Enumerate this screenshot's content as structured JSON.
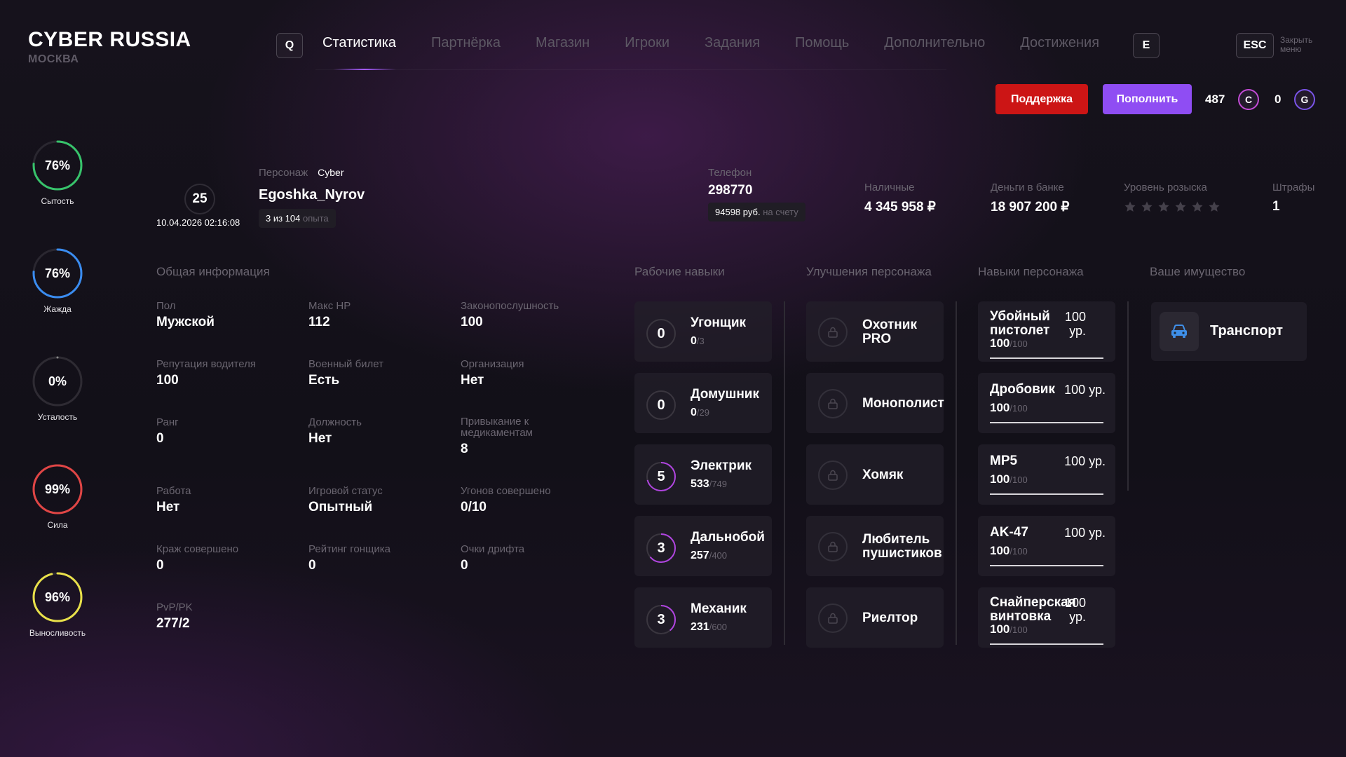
{
  "header": {
    "brand": "CYBER RUSSIA",
    "city": "МОСКВА",
    "left_key": "Q",
    "right_key": "E",
    "tabs": [
      {
        "label": "Статистика"
      },
      {
        "label": "Партнёрка"
      },
      {
        "label": "Магазин"
      },
      {
        "label": "Игроки"
      },
      {
        "label": "Задания"
      },
      {
        "label": "Помощь"
      },
      {
        "label": "Дополнительно"
      },
      {
        "label": "Достижения"
      }
    ],
    "esc_key": "ESC",
    "close_line1": "Закрыть",
    "close_line2": "меню"
  },
  "actions": {
    "support_label": "Поддержка",
    "topup_label": "Пополнить",
    "c_balance": "487",
    "c_symbol": "C",
    "g_balance": "0",
    "g_symbol": "G"
  },
  "stats": [
    {
      "value": "76%",
      "label": "Сытость",
      "fraction": 0.76,
      "color": "#37c36b"
    },
    {
      "value": "76%",
      "label": "Жажда",
      "fraction": 0.76,
      "color": "#3a8cf0"
    },
    {
      "value": "0%",
      "label": "Усталость",
      "fraction": 0.0,
      "color": "#8a8a8a"
    },
    {
      "value": "99%",
      "label": "Сила",
      "fraction": 0.99,
      "color": "#e04545"
    },
    {
      "value": "96%",
      "label": "Выносливость",
      "fraction": 0.96,
      "color": "#e8e04a"
    }
  ],
  "character": {
    "level": "25",
    "datetime": "10.04.2026 02:16:08",
    "character_label": "Персонаж",
    "tag": "Cyber",
    "name": "Egoshka_Nyrov",
    "exp_value": "3 из 104",
    "exp_unit": "опыта",
    "phone_label": "Телефон",
    "phone": "298770",
    "phone_balance": "94598 руб.",
    "phone_balance_suffix": "на счету",
    "cash_label": "Наличные",
    "cash": "4 345 958 ₽",
    "bank_label": "Деньги в банке",
    "bank": "18 907 200 ₽",
    "wanted_label": "Уровень розыска",
    "wanted_stars": 0,
    "fines_label": "Штрафы",
    "fines": "1"
  },
  "general": {
    "title": "Общая информация",
    "fields": [
      {
        "label": "Пол",
        "value": "Мужской"
      },
      {
        "label": "Макс HP",
        "value": "112"
      },
      {
        "label": "Законопослушность",
        "value": "100"
      },
      {
        "label": "Репутация водителя",
        "value": "100"
      },
      {
        "label": "Военный билет",
        "value": "Есть"
      },
      {
        "label": "Организация",
        "value": "Нет"
      },
      {
        "label": "Ранг",
        "value": "0"
      },
      {
        "label": "Должность",
        "value": "Нет"
      },
      {
        "label": "Привыкание к медикаментам",
        "value": "8"
      },
      {
        "label": "Работа",
        "value": "Нет"
      },
      {
        "label": "Игровой статус",
        "value": "Опытный"
      },
      {
        "label": "Угонов совершено",
        "value": "0/10"
      },
      {
        "label": "Краж совершено",
        "value": "0"
      },
      {
        "label": "Рейтинг гонщика",
        "value": "0"
      },
      {
        "label": "Очки дрифта",
        "value": "0"
      },
      {
        "label": "PvP/PK",
        "value": "277/2"
      }
    ]
  },
  "work_skills": {
    "title": "Рабочие навыки",
    "items": [
      {
        "level": "0",
        "name": "Угонщик",
        "current": "0",
        "max": "/3",
        "fraction": 0
      },
      {
        "level": "0",
        "name": "Домушник",
        "current": "0",
        "max": "/29",
        "fraction": 0
      },
      {
        "level": "5",
        "name": "Электрик",
        "current": "533",
        "max": "/749",
        "fraction": 0.71
      },
      {
        "level": "3",
        "name": "Дальнобой",
        "current": "257",
        "max": "/400",
        "fraction": 0.64
      },
      {
        "level": "3",
        "name": "Механик",
        "current": "231",
        "max": "/600",
        "fraction": 0.39
      }
    ]
  },
  "upgrades": {
    "title": "Улучшения персонажа",
    "items": [
      {
        "line1": "Охотник",
        "line2": "PRO"
      },
      {
        "line1": "Монополист",
        "line2": ""
      },
      {
        "line1": "Хомяк",
        "line2": ""
      },
      {
        "line1": "Любитель",
        "line2": "пушистиков"
      },
      {
        "line1": "Риелтор",
        "line2": ""
      }
    ]
  },
  "char_skills": {
    "title": "Навыки персонажа",
    "items": [
      {
        "name1": "Убойный",
        "name2": "пистолет",
        "lvl1": "100",
        "lvl2": "ур.",
        "current": "100",
        "max": "/100"
      },
      {
        "name1": "Дробовик",
        "name2": "",
        "lvl1": "100 ур.",
        "lvl2": "",
        "current": "100",
        "max": "/100"
      },
      {
        "name1": "MP5",
        "name2": "",
        "lvl1": "100 ур.",
        "lvl2": "",
        "current": "100",
        "max": "/100"
      },
      {
        "name1": "AK-47",
        "name2": "",
        "lvl1": "100 ур.",
        "lvl2": "",
        "current": "100",
        "max": "/100"
      },
      {
        "name1": "Снайперская",
        "name2": "винтовка",
        "lvl1": "100",
        "lvl2": "ур.",
        "current": "100",
        "max": "/100"
      }
    ]
  },
  "property": {
    "title": "Ваше имущество",
    "items": [
      {
        "label": "Транспорт",
        "icon": "car-icon"
      }
    ]
  },
  "colors": {
    "accent": "#8f4df3",
    "danger": "#cc1515"
  }
}
